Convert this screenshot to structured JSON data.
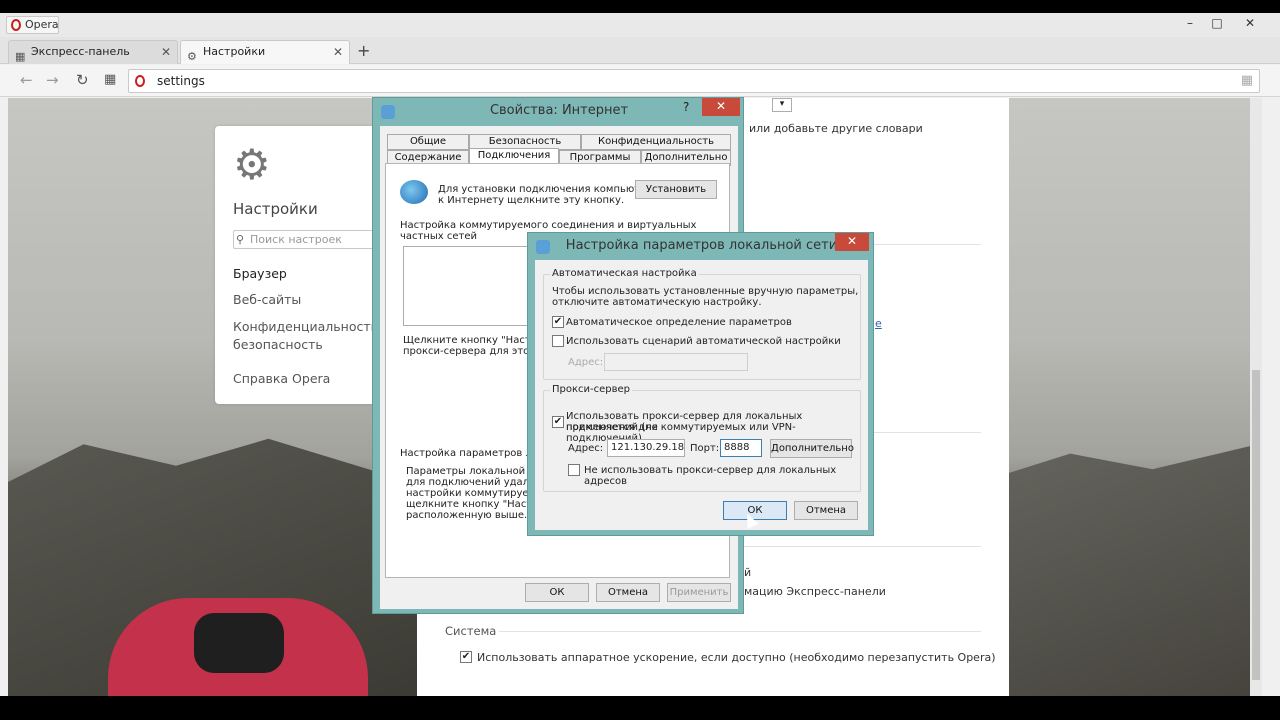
{
  "browser": {
    "menu_label": "Opera",
    "tabs": [
      {
        "label": "Экспресс-панель",
        "icon": "grid-icon"
      },
      {
        "label": "Настройки",
        "icon": "gear-icon"
      }
    ],
    "url": "settings",
    "new_tab": "+"
  },
  "sidebar": {
    "title": "Настройки",
    "search_placeholder": "Поиск настроек",
    "items": [
      "Браузер",
      "Веб-сайты",
      "Конфиденциальность",
      "безопасность",
      "Справка Opera"
    ]
  },
  "main": {
    "dict_text": "или добавьте другие словари",
    "link_text": "е",
    "partial_1": "й",
    "partial_2": "мацию Экспресс-панели",
    "system_heading": "Система",
    "hw_accel": "Использовать аппаратное ускорение, если доступно (необходимо перезапустить Opera)"
  },
  "internet_props": {
    "title": "Свойства: Интернет",
    "help": "?",
    "close": "✕",
    "tabs_row1": [
      "Общие",
      "Безопасность",
      "Конфиденциальность"
    ],
    "tabs_row2": [
      "Содержание",
      "Подключения",
      "Программы",
      "Дополнительно"
    ],
    "setup_text_1": "Для установки подключения компьютера",
    "setup_text_2": "к Интернету щелкните эту кнопку.",
    "setup_button": "Установить",
    "dialup_label_1": "Настройка коммутируемого соединения и виртуальных",
    "dialup_label_2": "частных сетей",
    "click_text_1": "Щелкните кнопку \"Настрой",
    "click_text_2": "прокси-сервера для этого п",
    "lan_label": "Настройка параметров локал",
    "lan_desc_1": "Параметры локальной сети",
    "lan_desc_2": "для подключений удален",
    "lan_desc_3": "настройки коммутируемого",
    "lan_desc_4": "щелкните кнопку \"Настрой",
    "lan_desc_5": "расположенную выше.",
    "ok": "ОК",
    "cancel": "Отмена",
    "apply": "Применить"
  },
  "lan_settings": {
    "title": "Настройка параметров локальной сети",
    "close": "✕",
    "auto_group": "Автоматическая настройка",
    "auto_desc_1": "Чтобы использовать установленные вручную параметры,",
    "auto_desc_2": "отключите автоматическую настройку.",
    "auto_detect": "Автоматическое определение параметров",
    "auto_detect_checked": true,
    "use_script": "Использовать сценарий автоматической настройки",
    "use_script_checked": false,
    "script_address_label": "Адрес:",
    "proxy_group": "Прокси-сервер",
    "use_proxy_1": "Использовать прокси-сервер для локальных подключений (не",
    "use_proxy_2": "применяется для коммутируемых или VPN-подключений).",
    "use_proxy_checked": true,
    "address_label": "Адрес:",
    "address_value": "121.130.29.184",
    "port_label": "Порт:",
    "port_value": "8888",
    "advanced": "Дополнительно",
    "bypass_local": "Не использовать прокси-сервер для локальных адресов",
    "bypass_checked": false,
    "ok": "ОК",
    "cancel": "Отмена"
  }
}
